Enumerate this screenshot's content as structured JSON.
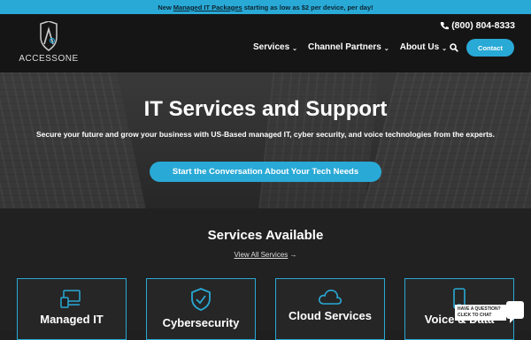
{
  "announcement": {
    "prefix": "New",
    "link": "Managed IT Packages",
    "suffix": "starting as low as $2 per device, per day!"
  },
  "header": {
    "logo_text": "ACCESSONE",
    "phone": "(800) 804-8333",
    "nav": [
      {
        "label": "Services"
      },
      {
        "label": "Channel Partners"
      },
      {
        "label": "About Us"
      }
    ],
    "contact_label": "Contact",
    "icons": [
      "phone-icon",
      "chevron-down-icon",
      "search-icon"
    ]
  },
  "hero": {
    "title": "IT Services and Support",
    "subtitle": "Secure your future and grow your business with US-Based managed IT, cyber security, and voice technologies from the experts.",
    "cta_label": "Start the Conversation About Your Tech Needs"
  },
  "services": {
    "title": "Services Available",
    "view_all": "View All Services",
    "arrow": "→",
    "cards": [
      {
        "label": "Managed IT",
        "icon": "computer-icon"
      },
      {
        "label": "Cybersecurity",
        "icon": "shield-check-icon"
      },
      {
        "label": "Cloud Services",
        "icon": "cloud-icon"
      },
      {
        "label": "Voice & Data",
        "icon": "phone-device-icon"
      }
    ]
  },
  "chat": {
    "line1": "HAVE A QUESTION?",
    "line2": "CLICK TO CHAT"
  },
  "colors": {
    "accent": "#29a9d6",
    "header_bg": "#151515",
    "section_bg": "#212121"
  }
}
